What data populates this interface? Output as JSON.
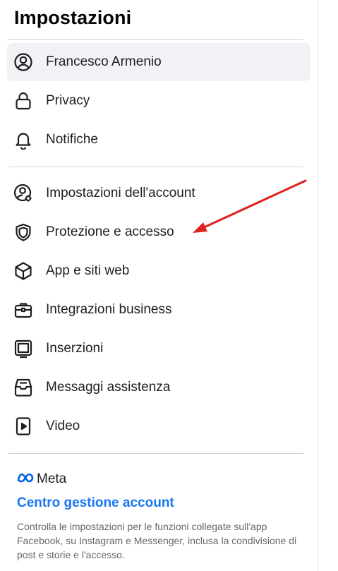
{
  "header": {
    "title": "Impostazioni"
  },
  "menu": {
    "profile": {
      "label": "Francesco Armenio",
      "icon": "user-circle-icon"
    },
    "group1": [
      {
        "label": "Privacy",
        "icon": "lock-icon"
      },
      {
        "label": "Notifiche",
        "icon": "bell-icon"
      }
    ],
    "group2": [
      {
        "label": "Impostazioni dell'account",
        "icon": "account-settings-icon"
      },
      {
        "label": "Protezione e accesso",
        "icon": "shield-icon"
      },
      {
        "label": "App e siti web",
        "icon": "cube-icon"
      },
      {
        "label": "Integrazioni business",
        "icon": "briefcase-icon"
      },
      {
        "label": "Inserzioni",
        "icon": "ads-icon"
      },
      {
        "label": "Messaggi assistenza",
        "icon": "inbox-icon"
      },
      {
        "label": "Video",
        "icon": "video-icon"
      }
    ]
  },
  "footer": {
    "meta_brand": "Meta",
    "link": "Centro gestione account",
    "description": "Controlla le impostazioni per le funzioni collegate sull'app Facebook, su Instagram e Messenger, inclusa la condivisione di post e storie e l'accesso."
  },
  "annotation": {
    "arrow_color": "#e02020"
  },
  "colors": {
    "link": "#1877f2",
    "active_bg": "#f0f2f5",
    "text": "#1c1e21",
    "muted": "#65676b"
  }
}
